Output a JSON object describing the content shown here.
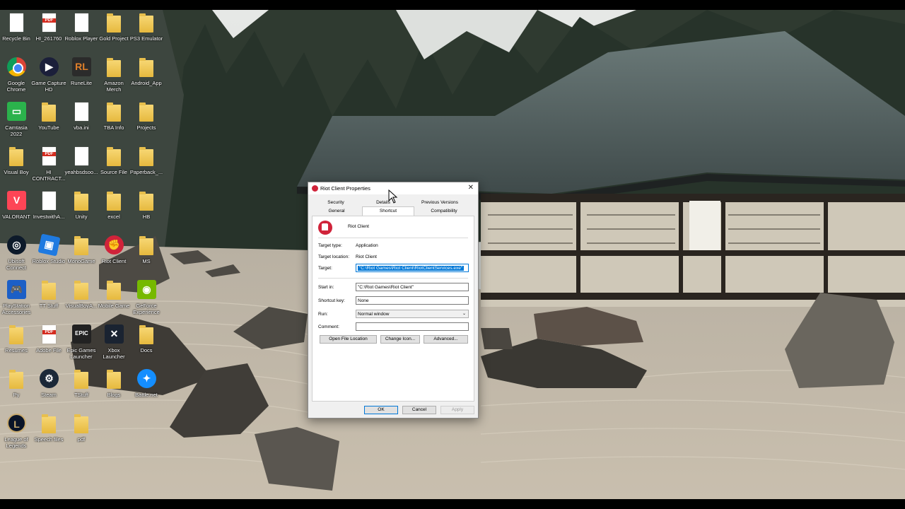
{
  "desktop": {
    "icons": [
      {
        "label": "Recycle Bin",
        "kind": "doc"
      },
      {
        "label": "HI_261760",
        "kind": "pdf"
      },
      {
        "label": "Roblox Player",
        "kind": "doc"
      },
      {
        "label": "Gold Project",
        "kind": "folder"
      },
      {
        "label": "PS3 Emulator",
        "kind": "folder"
      },
      {
        "label": "Google Chrome",
        "kind": "chrome"
      },
      {
        "label": "Game Capture HD",
        "kind": "capture"
      },
      {
        "label": "RuneLite",
        "kind": "runelite"
      },
      {
        "label": "Amazon Merch",
        "kind": "folder"
      },
      {
        "label": "Android_App",
        "kind": "folder"
      },
      {
        "label": "Camtasia 2022",
        "kind": "camtasia"
      },
      {
        "label": "YouTube",
        "kind": "folder"
      },
      {
        "label": "vba.ini",
        "kind": "doc"
      },
      {
        "label": "TBA Info",
        "kind": "folder"
      },
      {
        "label": "Projects",
        "kind": "folder"
      },
      {
        "label": "Visual Boy",
        "kind": "folder"
      },
      {
        "label": "HI CONTRACT...",
        "kind": "pdf"
      },
      {
        "label": "yeahbsdsoo...",
        "kind": "doc"
      },
      {
        "label": "Source File",
        "kind": "folder"
      },
      {
        "label": "Paperback_...",
        "kind": "folder"
      },
      {
        "label": "VALORANT",
        "kind": "valorant"
      },
      {
        "label": "InvestwithA...",
        "kind": "doc"
      },
      {
        "label": "Unity",
        "kind": "folder"
      },
      {
        "label": "excel",
        "kind": "folder"
      },
      {
        "label": "HB",
        "kind": "folder"
      },
      {
        "label": "Ubisoft Connect",
        "kind": "ubisoft"
      },
      {
        "label": "Roblox Studio",
        "kind": "roblox"
      },
      {
        "label": "MonoGame",
        "kind": "folder"
      },
      {
        "label": "Riot Client",
        "kind": "riot"
      },
      {
        "label": "MS",
        "kind": "folder"
      },
      {
        "label": "PlayStation Accessories",
        "kind": "playstation"
      },
      {
        "label": "TT Stuff",
        "kind": "folder"
      },
      {
        "label": "VisualBoyA...",
        "kind": "folder"
      },
      {
        "label": "Mobile Game",
        "kind": "folder"
      },
      {
        "label": "GeForce Experience",
        "kind": "nvidia"
      },
      {
        "label": "Resumes",
        "kind": "folder"
      },
      {
        "label": "Adobe File",
        "kind": "pdf"
      },
      {
        "label": "Epic Games Launcher",
        "kind": "epic"
      },
      {
        "label": "Xbox Launcher",
        "kind": "xbox"
      },
      {
        "label": "Docs",
        "kind": "folder"
      },
      {
        "label": "Py",
        "kind": "folder"
      },
      {
        "label": "Steam",
        "kind": "steam"
      },
      {
        "label": "TStuff",
        "kind": "folder"
      },
      {
        "label": "Blogs",
        "kind": "folder"
      },
      {
        "label": "Battle.net",
        "kind": "battlenet"
      },
      {
        "label": "League of Legends",
        "kind": "league"
      },
      {
        "label": "Speech files",
        "kind": "folder"
      },
      {
        "label": "pdf",
        "kind": "folder"
      }
    ]
  },
  "dialog": {
    "title": "Riot Client Properties",
    "close": "✕",
    "tabs_row1": [
      "Security",
      "Details",
      "Previous Versions"
    ],
    "tabs_row2": [
      "General",
      "Shortcut",
      "Compatibility"
    ],
    "active_tab": "Shortcut",
    "app_name": "Riot Client",
    "target_type_label": "Target type:",
    "target_type_value": "Application",
    "target_location_label": "Target location:",
    "target_location_value": "Riot Client",
    "target_label": "Target:",
    "target_value": "\"C:\\Riot Games\\Riot Client\\RiotClientServices.exe\"",
    "start_in_label": "Start in:",
    "start_in_value": "\"C:\\Riot Games\\Riot Client\"",
    "shortcut_key_label": "Shortcut key:",
    "shortcut_key_value": "None",
    "run_label": "Run:",
    "run_value": "Normal window",
    "comment_label": "Comment:",
    "comment_value": "",
    "open_file_location": "Open File Location",
    "change_icon": "Change Icon...",
    "advanced": "Advanced...",
    "ok": "OK",
    "cancel": "Cancel",
    "apply": "Apply"
  }
}
